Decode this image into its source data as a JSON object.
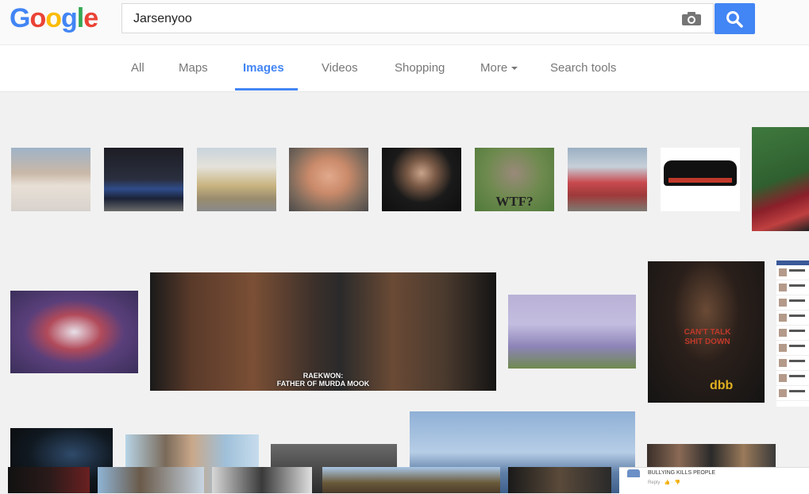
{
  "logo": {
    "text": "Google",
    "letters": [
      "G",
      "o",
      "o",
      "g",
      "l",
      "e"
    ],
    "colors": [
      "#4285f4",
      "#ea4335",
      "#fbbc05",
      "#4285f4",
      "#34a853",
      "#ea4335"
    ]
  },
  "search": {
    "value": "Jarsenyoo",
    "camera_icon": "camera-icon",
    "search_icon": "magnifier-icon"
  },
  "nav": {
    "all": "All",
    "maps": "Maps",
    "images": "Images",
    "videos": "Videos",
    "shopping": "Shopping",
    "more": "More",
    "search_tools": "Search tools"
  },
  "captions": {
    "wtf": "WTF?",
    "raekwon": "RAEKWON:",
    "raekwon_sub": "FATHER OF MURDA MOOK",
    "shirt": "CAN'T TALK SHIT DOWN",
    "dbb": "dbb",
    "bullying": "BULLYING KILLS PEOPLE",
    "reply": "Reply · 👍 · 👎"
  },
  "colors": {
    "accent": "#4285f4",
    "page_bg": "#f1f1f1"
  }
}
